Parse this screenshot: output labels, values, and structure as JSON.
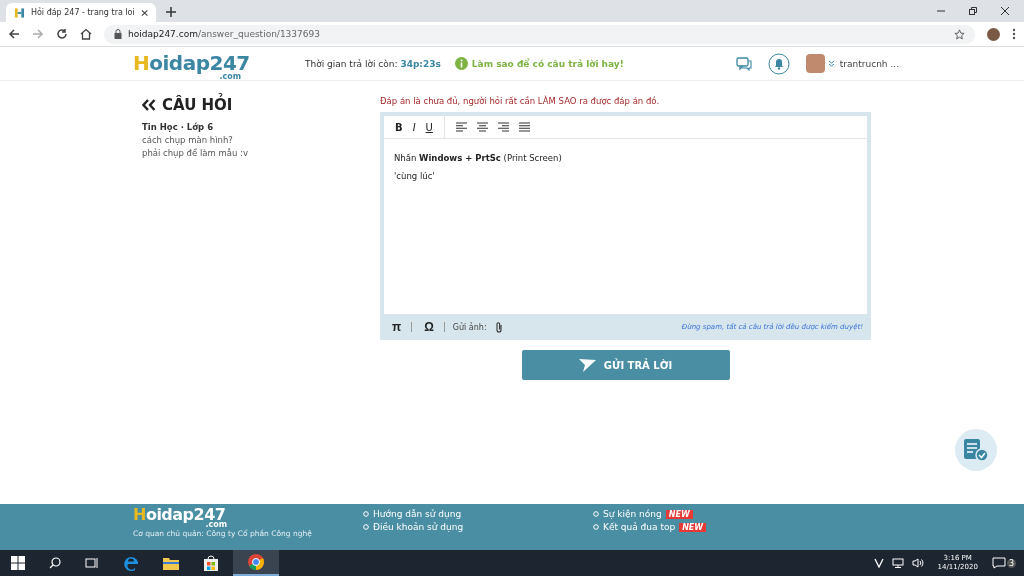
{
  "browser": {
    "tab_title": "Hỏi đáp 247 - trang tra loi",
    "url_domain": "hoidap247.com",
    "url_path": "/answer_question/1337693"
  },
  "header": {
    "logo": "Hoidap247",
    "logo_suffix": ".com",
    "timer_label": "Thời gian trả lời còn:",
    "timer_value": "34p:23s",
    "tip": "Làm sao để có câu trả lời hay!",
    "username": "trantrucnh ..."
  },
  "question": {
    "heading": "CÂU HỎI",
    "subject": "Tin Học · Lớp 6",
    "lines": [
      "cách chụp màn hình?",
      "phải chụp để làm mẫu :v"
    ]
  },
  "editor": {
    "warning": "Đáp án là chưa đủ, người hỏi rất cần LÀM SAO ra được đáp án đó.",
    "format_buttons": [
      "B",
      "I",
      "U"
    ],
    "content": [
      "Nhấn **Windows + PrtSc** (Print Screen)",
      "'cùng lúc'"
    ],
    "bottom_tools": [
      "π",
      "Ω"
    ],
    "image_label": "Gửi ảnh:",
    "notice": "Đừng spam, tất cả câu trả lời đều được kiểm duyệt!"
  },
  "submit_button": "GỬI TRẢ LỜI",
  "footer": {
    "logo": "Hoidap247",
    "logo_suffix": ".com",
    "org": "Cơ quan chủ quản: Công ty Cổ phần Công nghệ",
    "links_1": [
      {
        "label": "Hướng dẫn sử dụng"
      },
      {
        "label": "Điều khoản sử dụng"
      }
    ],
    "links_2": [
      {
        "label": "Sự kiện nóng",
        "badge": "NEW"
      },
      {
        "label": "Kết quả đua top",
        "badge": "NEW"
      }
    ]
  },
  "taskbar": {
    "time": "3:16 PM",
    "date": "14/11/2020",
    "notifications": "3"
  }
}
